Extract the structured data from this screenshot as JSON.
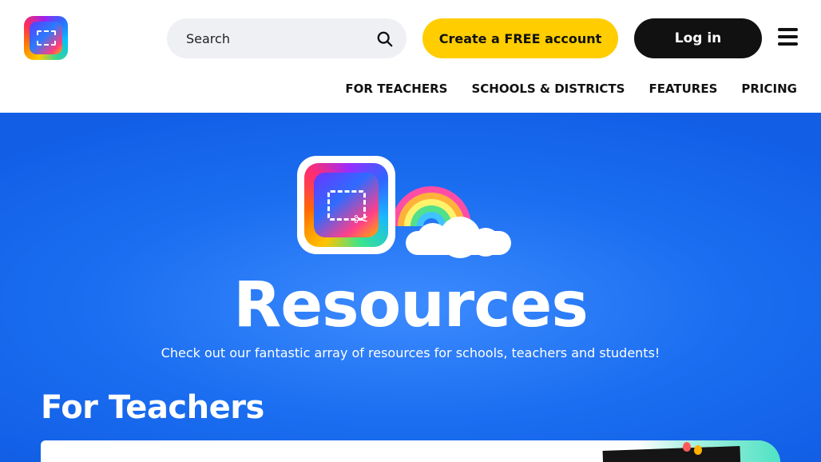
{
  "header": {
    "search": {
      "placeholder": "Search"
    },
    "create_account_label": "Create a FREE account",
    "login_label": "Log in",
    "nav": [
      {
        "label": "FOR TEACHERS"
      },
      {
        "label": "SCHOOLS & DISTRICTS"
      },
      {
        "label": "FEATURES"
      },
      {
        "label": "PRICING"
      }
    ]
  },
  "hero": {
    "title": "Resources",
    "subtitle": "Check out our fantastic array of resources for schools, teachers and students!"
  },
  "sections": {
    "for_teachers": {
      "title": "For Teachers"
    }
  },
  "colors": {
    "accent_yellow": "#ffcd00",
    "hero_blue": "#1b6ef0",
    "dark": "#111111"
  },
  "icons": {
    "logo": "book-creator-logo-icon",
    "search": "search-icon",
    "menu": "hamburger-menu-icon"
  }
}
